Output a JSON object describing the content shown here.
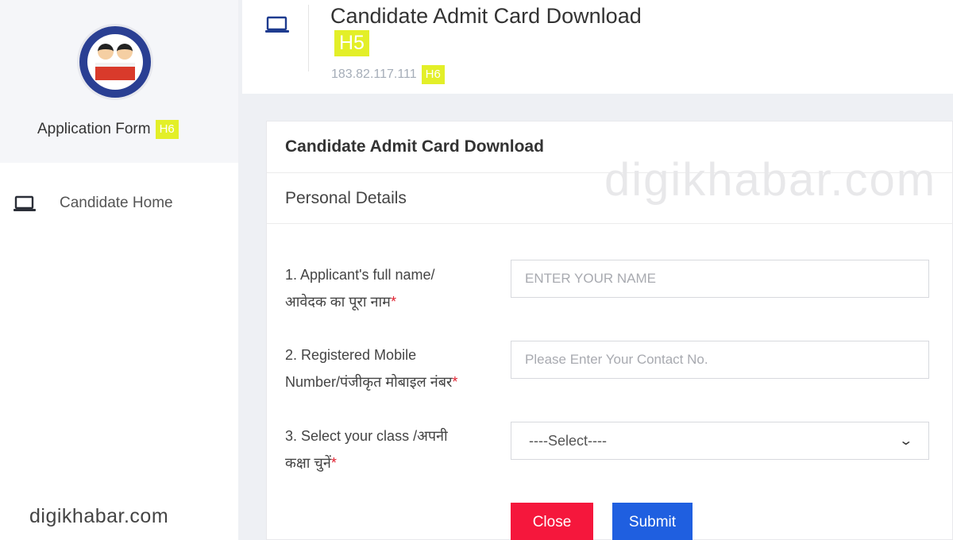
{
  "sidebar": {
    "brand_label": "Application Form",
    "brand_tag": "H6",
    "nav": [
      {
        "label": "Candidate Home",
        "icon": "laptop-icon"
      }
    ]
  },
  "header": {
    "title": "Candidate Admit Card Download",
    "title_tag": "H5",
    "ip": "183.82.117.111",
    "ip_tag": "H6",
    "icon": "laptop-icon"
  },
  "card": {
    "title": "Candidate Admit Card Download",
    "section": "Personal Details",
    "fields": [
      {
        "label_line1": "1. Applicant's full name/",
        "label_line2": "आवेदक का पूरा नाम",
        "required_mark": "*",
        "placeholder": "ENTER YOUR NAME",
        "value": ""
      },
      {
        "label_line1": "2. Registered Mobile",
        "label_line2": "Number/पंजीकृत मोबाइल नंबर",
        "required_mark": "*",
        "placeholder": "Please Enter Your Contact No.",
        "value": ""
      },
      {
        "label_line1": "3. Select your class /अपनी",
        "label_line2": "कक्षा चुनें",
        "required_mark": "*",
        "selected": "----Select----"
      }
    ],
    "buttons": {
      "close": "Close",
      "submit": "Submit"
    }
  },
  "watermarks": {
    "top": "digikhabar.com",
    "bottom": "digikhabar.com"
  },
  "colors": {
    "tag": "#e3ef28",
    "close": "#f5173c",
    "submit": "#1f5fe0",
    "required": "#e0202f"
  }
}
